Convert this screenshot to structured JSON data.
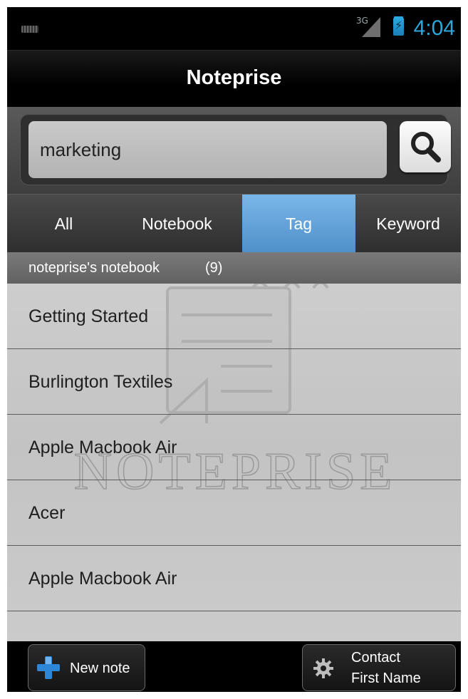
{
  "status_bar": {
    "network": "3G",
    "clock": "4:04",
    "icons": [
      "keyboard-icon",
      "signal-icon",
      "battery-charging-icon"
    ]
  },
  "app": {
    "title": "Noteprise"
  },
  "search": {
    "value": "marketing",
    "placeholder": "",
    "button_icon": "search-icon"
  },
  "tabs": [
    {
      "label": "All",
      "active": false
    },
    {
      "label": "Notebook",
      "active": false
    },
    {
      "label": "Tag",
      "active": true
    },
    {
      "label": "Keyword",
      "active": false
    }
  ],
  "section": {
    "title": "noteprise's notebook",
    "count": "(9)"
  },
  "watermark_text": "NOTEPRISE",
  "notes": [
    {
      "title": "Getting Started"
    },
    {
      "title": "Burlington Textiles"
    },
    {
      "title": "Apple Macbook Air"
    },
    {
      "title": "Acer"
    },
    {
      "title": "Apple Macbook Air"
    }
  ],
  "bottom_bar": {
    "new_note_label": "New note",
    "contact_line1": "Contact",
    "contact_line2": "First Name",
    "icons": [
      "plus-icon",
      "gear-icon"
    ]
  },
  "colors": {
    "accent": "#2BA7DC",
    "active_tab": "#5A9BD3"
  }
}
